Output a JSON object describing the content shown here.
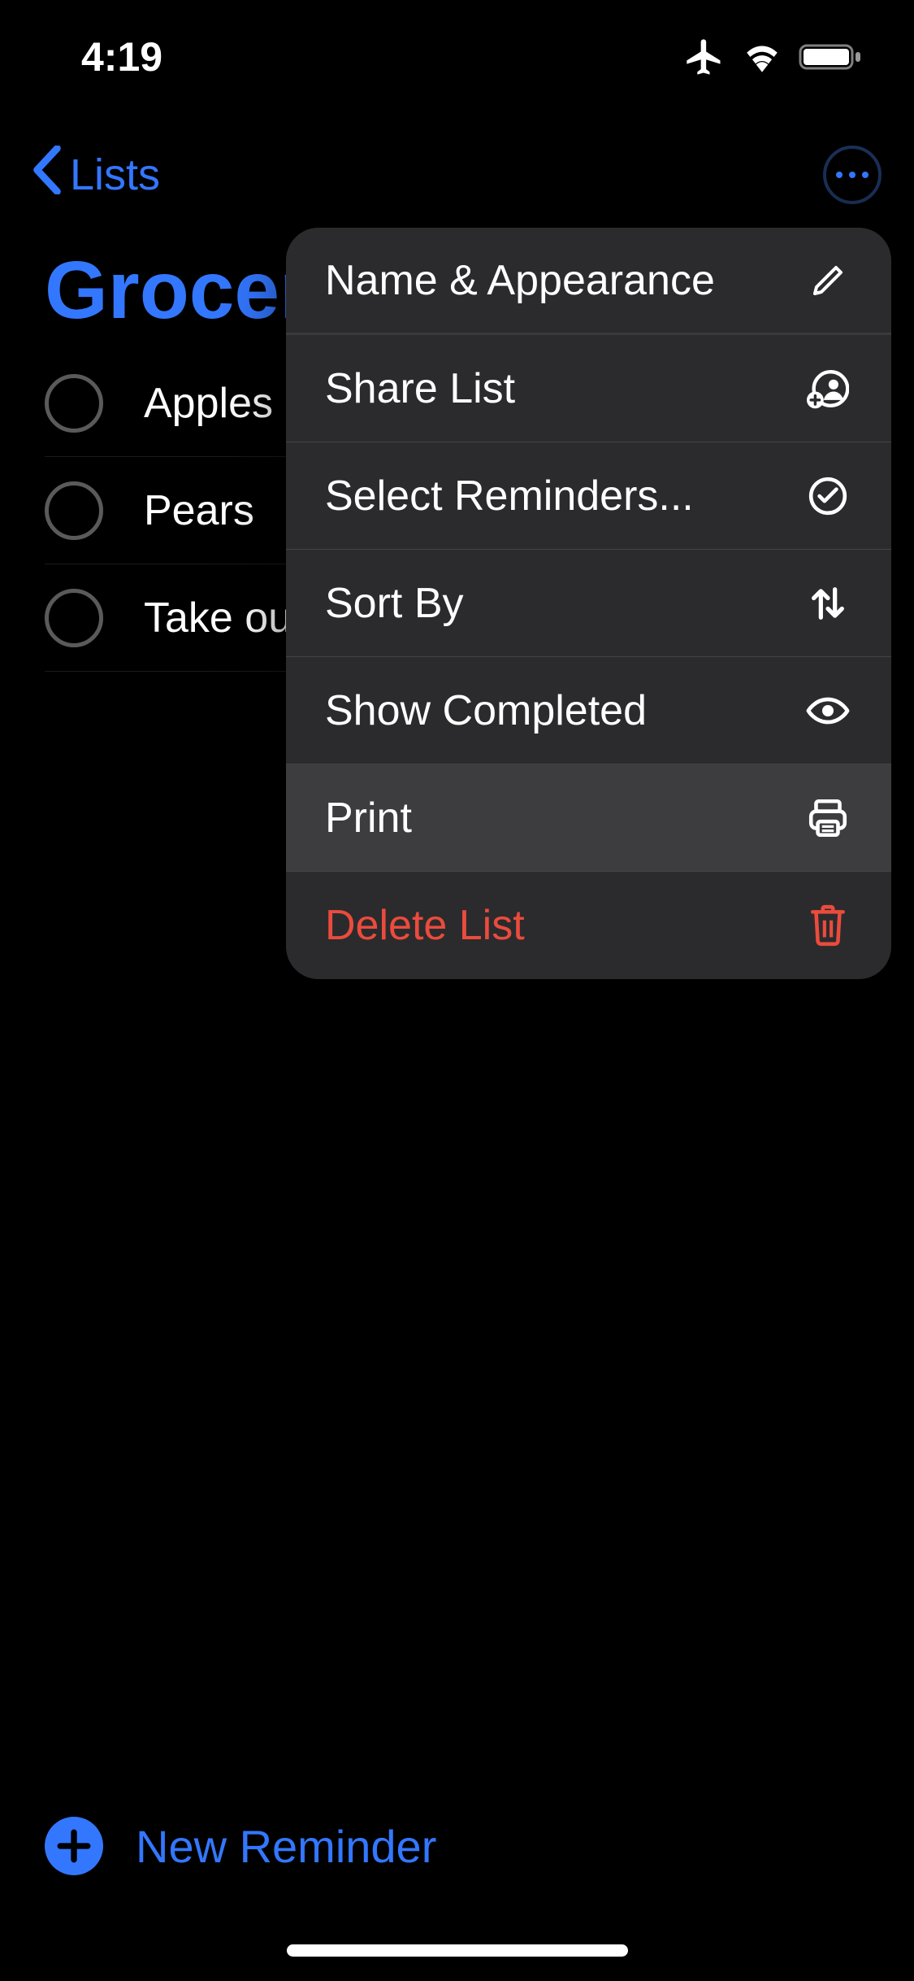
{
  "status": {
    "time": "4:19"
  },
  "nav": {
    "back_label": "Lists"
  },
  "list": {
    "title": "Groceries",
    "items": [
      {
        "label": "Apples"
      },
      {
        "label": "Pears"
      },
      {
        "label": "Take out"
      }
    ]
  },
  "menu": {
    "items": [
      {
        "label": "Name & Appearance",
        "icon": "pencil",
        "destructive": false,
        "highlighted": false,
        "separator": true
      },
      {
        "label": "Share List",
        "icon": "person-add",
        "destructive": false,
        "highlighted": false,
        "separator": false
      },
      {
        "label": "Select Reminders...",
        "icon": "check-circle",
        "destructive": false,
        "highlighted": false,
        "separator": false
      },
      {
        "label": "Sort By",
        "icon": "sort-arrows",
        "destructive": false,
        "highlighted": false,
        "separator": false
      },
      {
        "label": "Show Completed",
        "icon": "eye",
        "destructive": false,
        "highlighted": false,
        "separator": false
      },
      {
        "label": "Print",
        "icon": "printer",
        "destructive": false,
        "highlighted": true,
        "separator": false
      },
      {
        "label": "Delete List",
        "icon": "trash",
        "destructive": true,
        "highlighted": false,
        "separator": false
      }
    ]
  },
  "footer": {
    "new_reminder_label": "New Reminder"
  },
  "colors": {
    "accent": "#3377ff",
    "destructive": "#eb4b3d"
  }
}
